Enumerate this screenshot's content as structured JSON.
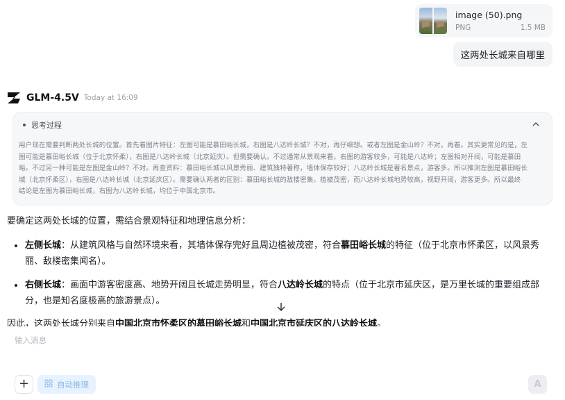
{
  "attachment": {
    "file_name": "image (50).png",
    "file_type": "PNG",
    "file_size": "1.5 MB"
  },
  "user_message": "这两处长城来自哪里",
  "model": {
    "name": "GLM-4.5V",
    "time": "Today at 16:09"
  },
  "thinking": {
    "label": "思考过程",
    "lines": [
      "用户现在需要判断两处长城的位置。首先看图片特征：左图可能是慕田峪长城，右图是八达岭长城？不对，再仔细想。或者左图是金山岭？不对，再看。其实更常见的是，左",
      "图可能是慕田峪长城（位于北京怀柔），右图是八达岭长城（北京延庆）。但需要确认。不过通常从景观来看，右图的游客较多，可能是八达岭；左图相对开阔，可能是慕田",
      "峪。不过另一种可能是左图是金山岭？不对。再查资料：慕田峪长城以风景秀丽、建筑独特著称，墙体保存较好；八达岭长城是著名景点，游客多。所以推测左图是慕田峪长",
      "城（北京怀柔区），右图是八达岭长城（北京延庆区）。需要确认两者的区别：慕田峪长城的敌楼密集，植被茂密，而八达岭长城地势较高，视野开阔，游客更多。所以最终",
      "结论是左图为慕田峪长城，右图为八达岭长城，均位于中国北京市。"
    ]
  },
  "answer": {
    "intro": "要确定这两处长城的位置，需结合景观特征和地理信息分析：",
    "left": {
      "label": "左侧长城",
      "text_a": "：从建筑风格与自然环境来看，其墙体保存完好且周边植被茂密，符合",
      "highlight": "慕田峪长城",
      "text_b": "的特征（位于北京市怀柔区，以风景秀丽、敌楼密集闻名）。"
    },
    "right": {
      "label": "右侧长城",
      "text_a": "：画面中游客密度高、地势开阔且长城走势明显，符合",
      "highlight": "八达岭长城",
      "text_b": "的特点（位于北京市延庆区，是万里长城的重要组成部分，也是知名度极高的旅游景点）。"
    },
    "conclusion": {
      "text_a": "因此，这两处长城分别来自",
      "place_a": "中国北京市怀柔区的慕田峪长城",
      "text_b": "和",
      "place_b": "中国北京市延庆区的八达岭长城",
      "text_c": "。"
    }
  },
  "input": {
    "placeholder": "输入消息",
    "plus_label": "+",
    "reasoning_label": "自动推理",
    "send_label": "A"
  },
  "icons": {
    "scroll_down": "arrow-down-icon",
    "collapse": "chevron-up-icon",
    "logo": "z-logo-icon"
  }
}
